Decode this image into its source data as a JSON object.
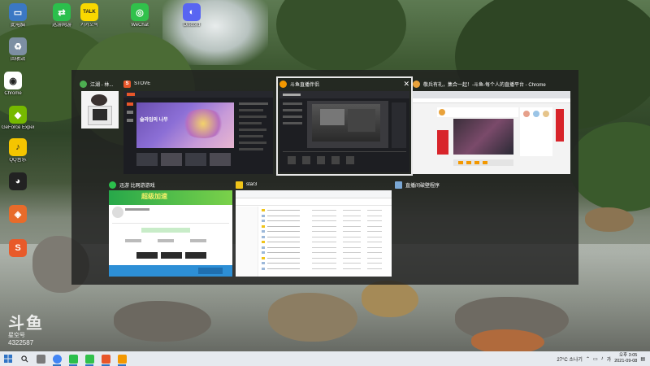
{
  "desktop": {
    "icons": [
      {
        "label": "此电脑",
        "color": "#3b78c4",
        "glyph": "▭"
      },
      {
        "label": "回收站",
        "color": "#7d8fa3",
        "glyph": "♻"
      },
      {
        "label": "Chrome",
        "color": "#ffffff",
        "glyph": "◉"
      },
      {
        "label": "GeForce Experience",
        "color": "#76b900",
        "glyph": "◆"
      },
      {
        "label": "QQ音乐",
        "color": "#f5c500",
        "glyph": "♪"
      },
      {
        "label": "",
        "color": "#222222",
        "glyph": "◕"
      },
      {
        "label": "",
        "color": "#e86b2a",
        "glyph": "◈"
      },
      {
        "label": "",
        "color": "#e85a2a",
        "glyph": "S"
      },
      {
        "label": "迅游网游",
        "color": "#2bbf4c",
        "glyph": "⇄"
      },
      {
        "label": "카카오톡",
        "color": "#f9d800",
        "glyph": "TALK"
      },
      {
        "label": "WeChat",
        "color": "#31c14b",
        "glyph": "◎"
      },
      {
        "label": "Discord",
        "color": "#5865f2",
        "glyph": "◐"
      }
    ]
  },
  "watermark": {
    "logo": "斗鱼",
    "sub": "星空号",
    "id": "4322587"
  },
  "switcher": {
    "windows": [
      {
        "title": "江湖 - 林...",
        "icon_color": "#4caf50"
      },
      {
        "title": "STOVE",
        "icon_color": "#e8562a",
        "icon_letter": "S"
      },
      {
        "title": "斗鱼直播伴侣",
        "icon_color": "#f39800",
        "selected": true,
        "close": "✕"
      },
      {
        "title": "敬兵有礼，集合一起！-斗鱼-每个人的直播平台 - Chrome",
        "icon_color": "#e9a23b"
      },
      {
        "title": "迅游 比网游游戏",
        "icon_color": "#2bbf4c"
      },
      {
        "title": "star3",
        "icon_color": "#f0c419"
      },
      {
        "title": "直播间破壁程序",
        "icon_color": "#7aa7d4"
      }
    ],
    "stove_thumb_text": "슬라임의 나무",
    "xunyou_banner": "超级加速"
  },
  "taskbar": {
    "apps": [
      {
        "color": "#7a7a7a"
      },
      {
        "color": "#4285f4"
      },
      {
        "color": "#2bbf4c"
      },
      {
        "color": "#31c14b"
      },
      {
        "color": "#e8562a"
      },
      {
        "color": "#f39800"
      }
    ],
    "weather": "27°C 소나기",
    "language": "가",
    "time": "오후 3:05",
    "date": "2021-09-08"
  },
  "colors": {
    "switcher_bg": "#202020",
    "taskbar_bg": "#e6eaef",
    "accent": "#2f73c5"
  }
}
